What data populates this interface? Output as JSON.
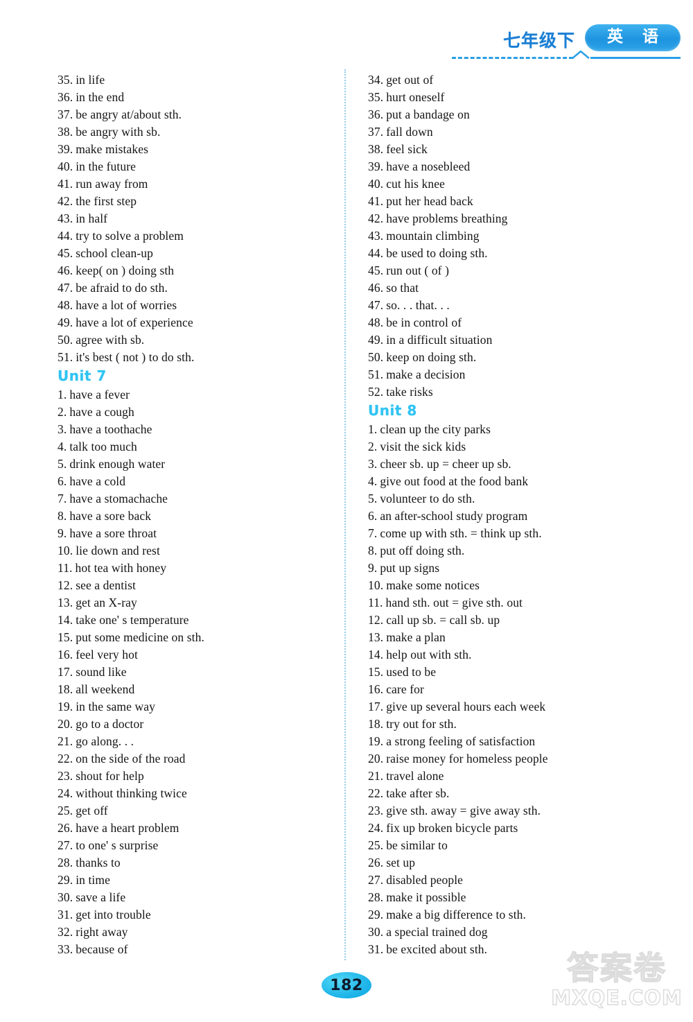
{
  "header": {
    "grade_label": "七年级下",
    "subject_badge": "英 语"
  },
  "page_number": "182",
  "watermark": {
    "chinese": "答案卷",
    "domain": "MXQE.COM"
  },
  "left_column": {
    "entries": [
      {
        "num": "35.",
        "text": "in life"
      },
      {
        "num": "36.",
        "text": "in the end"
      },
      {
        "num": "37.",
        "text": "be angry at/about sth."
      },
      {
        "num": "38.",
        "text": "be angry with sb."
      },
      {
        "num": "39.",
        "text": "make mistakes"
      },
      {
        "num": "40.",
        "text": "in the future"
      },
      {
        "num": "41.",
        "text": "run away from"
      },
      {
        "num": "42.",
        "text": "the first step"
      },
      {
        "num": "43.",
        "text": "in half"
      },
      {
        "num": "44.",
        "text": "try to solve a problem"
      },
      {
        "num": "45.",
        "text": "school clean-up"
      },
      {
        "num": "46.",
        "text": "keep( on ) doing sth"
      },
      {
        "num": "47.",
        "text": "be afraid to do sth."
      },
      {
        "num": "48.",
        "text": "have a lot of worries"
      },
      {
        "num": "49.",
        "text": "have a lot of experience"
      },
      {
        "num": "50.",
        "text": "agree with sb."
      },
      {
        "num": "51.",
        "text": "it's best ( not ) to do sth."
      }
    ],
    "unit_heading": "Unit 7",
    "unit_entries": [
      {
        "num": "1.",
        "text": "have a fever"
      },
      {
        "num": "2.",
        "text": "have a cough"
      },
      {
        "num": "3.",
        "text": "have a toothache"
      },
      {
        "num": "4.",
        "text": "talk too much"
      },
      {
        "num": "5.",
        "text": "drink enough water"
      },
      {
        "num": "6.",
        "text": "have a cold"
      },
      {
        "num": "7.",
        "text": "have a stomachache"
      },
      {
        "num": "8.",
        "text": "have a sore back"
      },
      {
        "num": "9.",
        "text": "have a sore throat"
      },
      {
        "num": "10.",
        "text": "lie down and rest"
      },
      {
        "num": "11.",
        "text": "hot tea with honey"
      },
      {
        "num": "12.",
        "text": "see a dentist"
      },
      {
        "num": "13.",
        "text": "get an X-ray"
      },
      {
        "num": "14.",
        "text": "take one' s temperature"
      },
      {
        "num": "15.",
        "text": "put some medicine on sth."
      },
      {
        "num": "16.",
        "text": "feel very hot"
      },
      {
        "num": "17.",
        "text": "sound like"
      },
      {
        "num": "18.",
        "text": "all weekend"
      },
      {
        "num": "19.",
        "text": "in the same way"
      },
      {
        "num": "20.",
        "text": "go to a doctor"
      },
      {
        "num": "21.",
        "text": "go along. . ."
      },
      {
        "num": "22.",
        "text": "on the side of the road"
      },
      {
        "num": "23.",
        "text": "shout for help"
      },
      {
        "num": "24.",
        "text": "without thinking twice"
      },
      {
        "num": "25.",
        "text": "get off"
      },
      {
        "num": "26.",
        "text": "have a heart problem"
      },
      {
        "num": "27.",
        "text": "to one' s surprise"
      },
      {
        "num": "28.",
        "text": "thanks to"
      },
      {
        "num": "29.",
        "text": "in time"
      },
      {
        "num": "30.",
        "text": "save a life"
      },
      {
        "num": "31.",
        "text": "get into trouble"
      },
      {
        "num": "32.",
        "text": "right away"
      },
      {
        "num": "33.",
        "text": "because of"
      }
    ]
  },
  "right_column": {
    "entries": [
      {
        "num": "34.",
        "text": "get out of"
      },
      {
        "num": "35.",
        "text": "hurt oneself"
      },
      {
        "num": "36.",
        "text": "put a bandage on"
      },
      {
        "num": "37.",
        "text": "fall down"
      },
      {
        "num": "38.",
        "text": "feel sick"
      },
      {
        "num": "39.",
        "text": "have a nosebleed"
      },
      {
        "num": "40.",
        "text": "cut his knee"
      },
      {
        "num": "41.",
        "text": "put her head back"
      },
      {
        "num": "42.",
        "text": "have problems breathing"
      },
      {
        "num": "43.",
        "text": "mountain climbing"
      },
      {
        "num": "44.",
        "text": "be used to doing sth."
      },
      {
        "num": "45.",
        "text": "run out ( of )"
      },
      {
        "num": "46.",
        "text": "so that"
      },
      {
        "num": "47.",
        "text": "so. . . that. . ."
      },
      {
        "num": "48.",
        "text": "be in control of"
      },
      {
        "num": "49.",
        "text": "in a difficult situation"
      },
      {
        "num": "50.",
        "text": "keep on doing sth."
      },
      {
        "num": "51.",
        "text": "make a decision"
      },
      {
        "num": "52.",
        "text": "take risks"
      }
    ],
    "unit_heading": "Unit 8",
    "unit_entries": [
      {
        "num": "1.",
        "text": "clean up the city parks"
      },
      {
        "num": "2.",
        "text": "visit the sick kids"
      },
      {
        "num": "3.",
        "text": "cheer sb. up = cheer up sb."
      },
      {
        "num": "4.",
        "text": "give out food at the food bank"
      },
      {
        "num": "5.",
        "text": "volunteer to do sth."
      },
      {
        "num": "6.",
        "text": "an after-school study program"
      },
      {
        "num": "7.",
        "text": "come up with sth. = think up sth."
      },
      {
        "num": "8.",
        "text": "put off doing sth."
      },
      {
        "num": "9.",
        "text": "put up signs"
      },
      {
        "num": "10.",
        "text": "make some notices"
      },
      {
        "num": "11.",
        "text": "hand sth. out = give sth. out"
      },
      {
        "num": "12.",
        "text": "call up sb. = call sb. up"
      },
      {
        "num": "13.",
        "text": "make a plan"
      },
      {
        "num": "14.",
        "text": "help out with sth."
      },
      {
        "num": "15.",
        "text": "used to be"
      },
      {
        "num": "16.",
        "text": "care for"
      },
      {
        "num": "17.",
        "text": "give up several hours each week"
      },
      {
        "num": "18.",
        "text": "try out for sth."
      },
      {
        "num": "19.",
        "text": "a strong feeling of satisfaction"
      },
      {
        "num": "20.",
        "text": "raise money for homeless people"
      },
      {
        "num": "21.",
        "text": "travel alone"
      },
      {
        "num": "22.",
        "text": "take after sb."
      },
      {
        "num": "23.",
        "text": "give sth. away = give away sth."
      },
      {
        "num": "24.",
        "text": "fix up broken bicycle parts"
      },
      {
        "num": "25.",
        "text": "be similar to"
      },
      {
        "num": "26.",
        "text": "set up"
      },
      {
        "num": "27.",
        "text": "disabled people"
      },
      {
        "num": "28.",
        "text": "make it possible"
      },
      {
        "num": "29.",
        "text": "make a big difference to sth."
      },
      {
        "num": "30.",
        "text": "a special trained dog"
      },
      {
        "num": "31.",
        "text": "be excited about sth."
      }
    ]
  }
}
